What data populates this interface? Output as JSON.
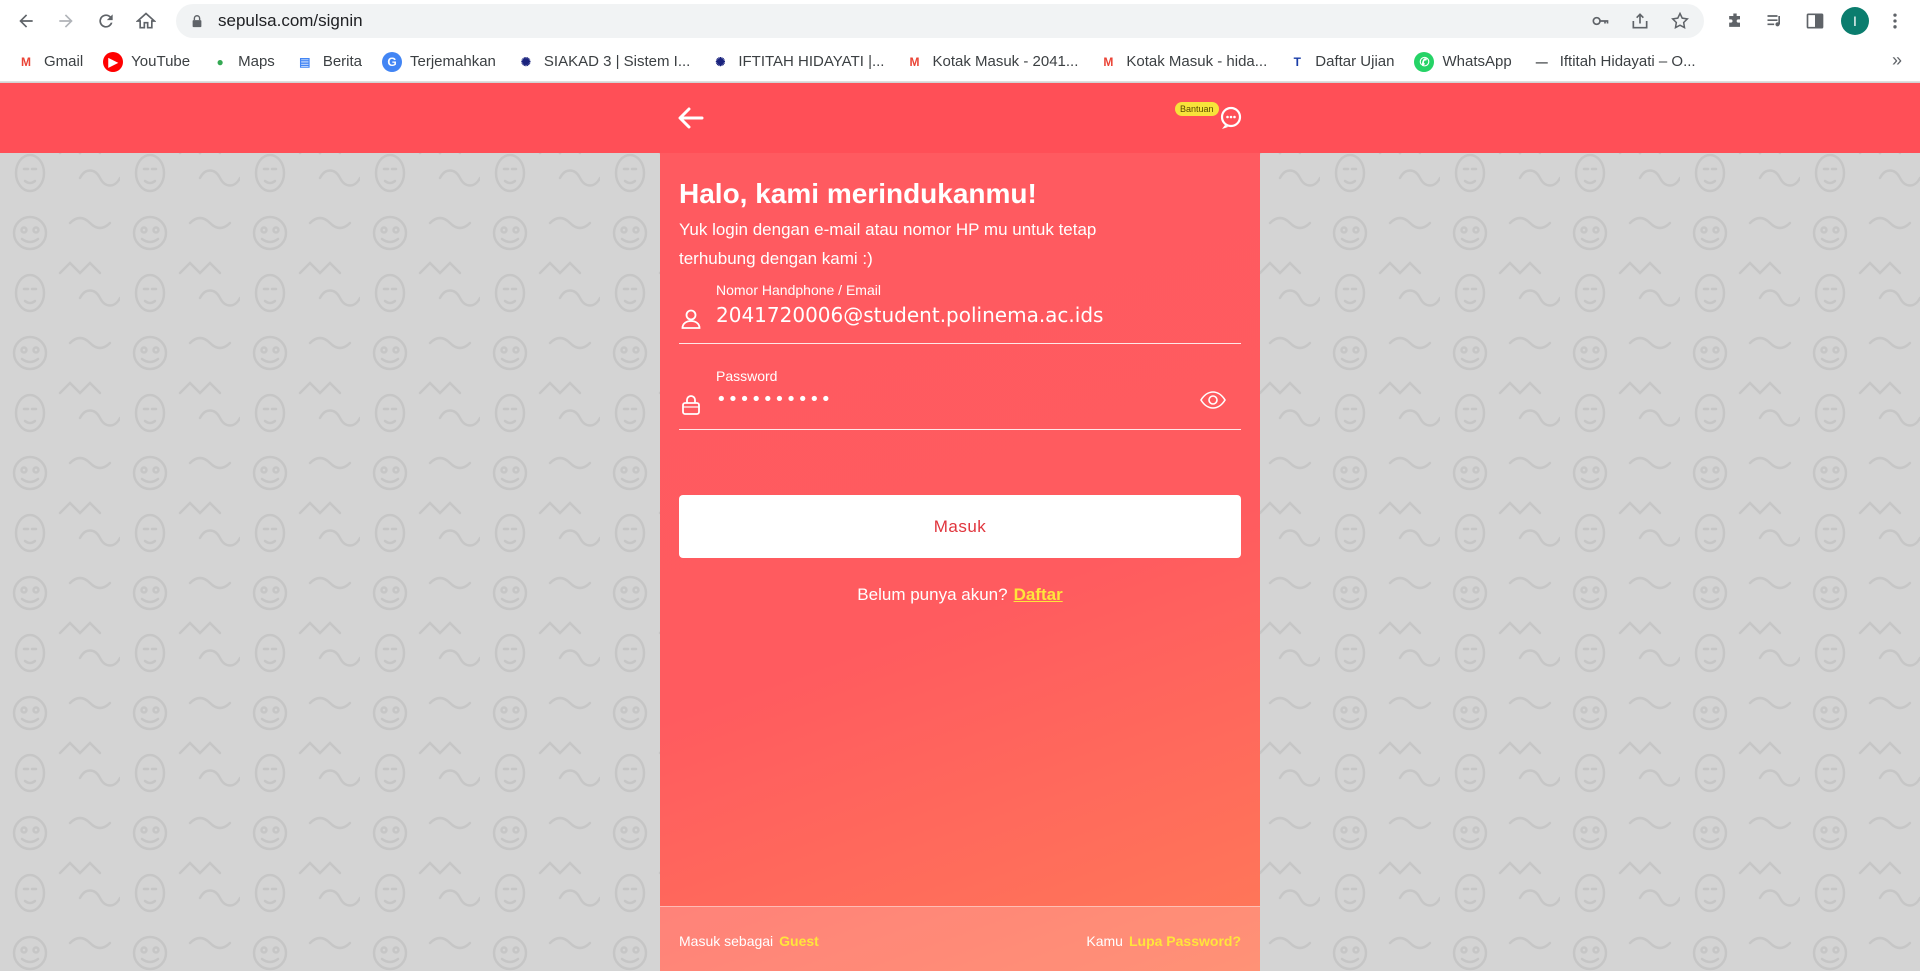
{
  "browser": {
    "url": "sepulsa.com/signin",
    "profile_initial": "I",
    "bookmarks": [
      {
        "label": "Gmail",
        "icon": "gmail-icon"
      },
      {
        "label": "YouTube",
        "icon": "youtube-icon"
      },
      {
        "label": "Maps",
        "icon": "maps-icon"
      },
      {
        "label": "Berita",
        "icon": "news-icon"
      },
      {
        "label": "Terjemahkan",
        "icon": "translate-icon"
      },
      {
        "label": "SIAKAD 3 | Sistem I...",
        "icon": "siakad-icon"
      },
      {
        "label": "IFTITAH HIDAYATI |...",
        "icon": "siakad-icon"
      },
      {
        "label": "Kotak Masuk - 2041...",
        "icon": "gmail-icon"
      },
      {
        "label": "Kotak Masuk - hida...",
        "icon": "gmail-icon"
      },
      {
        "label": "Daftar Ujian",
        "icon": "exam-icon"
      },
      {
        "label": "WhatsApp",
        "icon": "whatsapp-icon"
      },
      {
        "label": "Iftitah Hidayati – O...",
        "icon": "site-icon"
      }
    ],
    "more": "»"
  },
  "header": {
    "help_badge": "Bantuan"
  },
  "login": {
    "title": "Halo, kami merindukanmu!",
    "subtitle": "Yuk login dengan e-mail atau nomor HP mu untuk tetap terhubung dengan kami :)",
    "username_label": "Nomor Handphone / Email",
    "username_value": "2041720006@student.polinema.ac.ids",
    "password_label": "Password",
    "password_value": "••••••••••",
    "submit_label": "Masuk",
    "register_prompt": "Belum punya akun?",
    "register_link": "Daftar"
  },
  "footer": {
    "guest_prefix": "Masuk sebagai",
    "guest_link": "Guest",
    "forgot_prefix": "Kamu",
    "forgot_link": "Lupa Password?"
  },
  "colors": {
    "brand": "#ff4f57",
    "accent_yellow": "#ffe53b"
  }
}
